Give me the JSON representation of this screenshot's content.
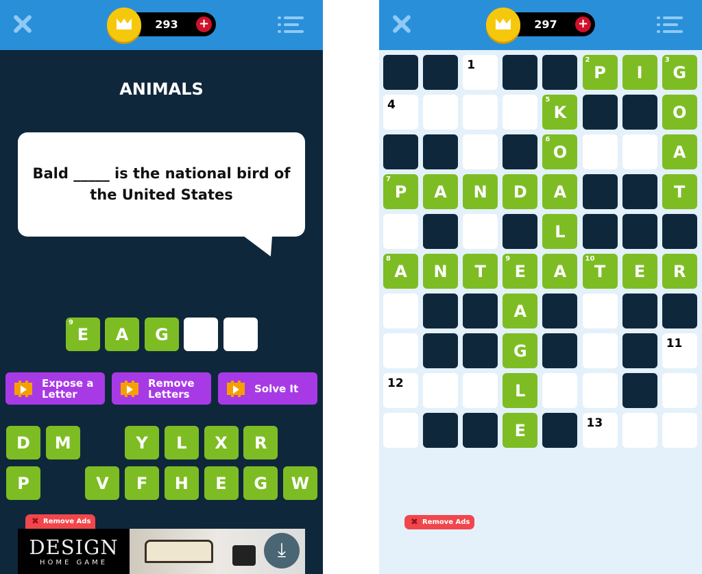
{
  "left": {
    "header": {
      "coins": "293",
      "close_icon": "close-icon",
      "menu_icon": "list-menu-icon",
      "plus_icon": "plus-icon"
    },
    "category": "ANIMALS",
    "clue": "Bald _____ is the national bird of the United States",
    "answer": {
      "number": "9",
      "tiles": [
        "E",
        "A",
        "G",
        "",
        ""
      ]
    },
    "powerups": [
      {
        "label": "Expose a Letter",
        "icon": "video-icon"
      },
      {
        "label": "Remove Letters",
        "icon": "video-icon"
      },
      {
        "label": "Solve It",
        "icon": "video-icon"
      }
    ],
    "letter_rows": [
      [
        "D",
        "M",
        "",
        "Y",
        "L",
        "X",
        "R",
        ""
      ],
      [
        "P",
        "",
        "V",
        "F",
        "H",
        "E",
        "G",
        "W"
      ]
    ],
    "remove_ads": "Remove Ads",
    "ad": {
      "brand": "DESIGN",
      "sub": "HOME GAME"
    }
  },
  "right": {
    "header": {
      "coins": "297"
    },
    "grid": [
      "##.##PIG",
      "....K##O",
      "##.#O..A",
      "PANDA##T",
      ".#.#L###",
      "ANTEATER",
      ".##A#.##",
      ".##G#.#.",
      "...L..#.",
      ".##E#..."
    ],
    "numbers": {
      "0,2": "1",
      "0,5": "2",
      "0,7": "3",
      "1,0": "4",
      "1,4": "5",
      "2,4": "6",
      "3,0": "7",
      "5,0": "8",
      "5,3": "9",
      "5,5": "10",
      "7,7": "11",
      "8,0": "12",
      "9,5": "13"
    },
    "remove_ads": "Remove Ads"
  },
  "colors": {
    "header": "#2a8fd9",
    "dark": "#0f273b",
    "green": "#7dbd23",
    "purple": "#a83ae6",
    "coin": "#f6c80b",
    "remove_ads": "#f0474c"
  }
}
